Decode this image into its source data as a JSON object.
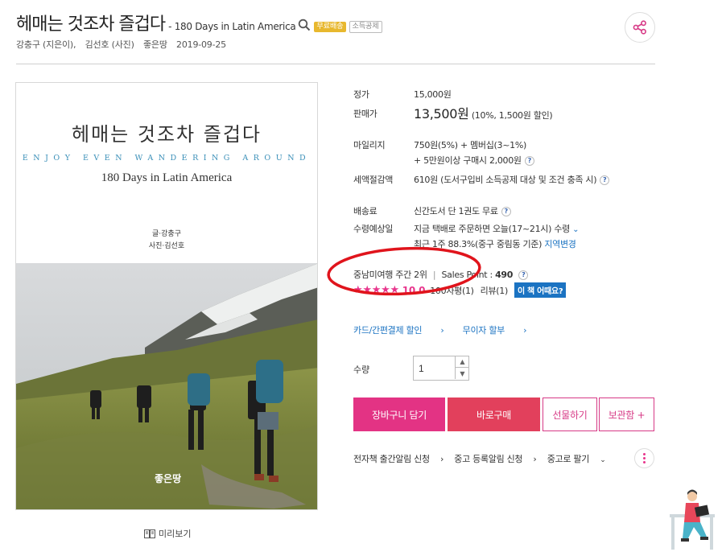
{
  "header": {
    "title": "헤매는 것조차 즐겁다",
    "subtitle": "- 180 Days in Latin America",
    "badge_free": "무료배송",
    "badge_tax": "소득공제",
    "byline": [
      "강충구 (지은이),",
      "김선호 (사진)",
      "좋은땅",
      "2019-09-25"
    ]
  },
  "cover": {
    "title": "헤매는 것조차 즐겁다",
    "english": "ENJOY EVEN WANDERING AROUND",
    "subtitle": "180 Days in Latin America",
    "credit_writer": "글·강충구",
    "credit_photo": "사진·김선호",
    "publisher_logo": "좋은땅",
    "preview_label": "미리보기"
  },
  "info": {
    "list_price_label": "정가",
    "list_price": "15,000원",
    "sale_price_label": "판매가",
    "sale_price": "13,500원",
    "sale_discount": "(10%, 1,500원 할인)",
    "mileage_label": "마일리지",
    "mileage_line1": "750원(5%) + 멤버십(3~1%)",
    "mileage_line2": "+ 5만원이상 구매시 2,000원",
    "tax_label": "세액절감액",
    "tax_value": "610원 (도서구입비 소득공제 대상 및 조건 충족 시)",
    "shipping_label": "배송료",
    "shipping_value": "신간도서 단 1권도 무료",
    "delivery_label": "수령예상일",
    "delivery_value": "지금 택배로 주문하면 오늘(17~21시) 수령",
    "delivery_stat": "최근 1주 88.3%(중구 중림동 기준)",
    "delivery_change": "지역변경",
    "rank": "중남미여행 주간 2위",
    "sales_point_label": "Sales Point :",
    "sales_point": "490",
    "score": "10.0",
    "review_count": "100자평(1)",
    "review_label": "리뷰(1)",
    "pill": "이 책 어때요?",
    "link_card": "카드/간편결제 할인",
    "link_installment": "무이자 할부",
    "qty_label": "수량",
    "qty_value": "1"
  },
  "buttons": {
    "cart": "장바구니 담기",
    "buy": "바로구매",
    "gift": "선물하기",
    "keep": "보관함 +"
  },
  "bottom_links": {
    "ebook": "전자책 출간알림 신청",
    "used_alert": "중고 등록알림 신청",
    "used_sell": "중고로 팔기"
  },
  "colors": {
    "cart": "#e33384",
    "buy": "#e2405c",
    "link": "#1b73c2",
    "star": "#e8358c",
    "annotation": "#e0141c"
  }
}
